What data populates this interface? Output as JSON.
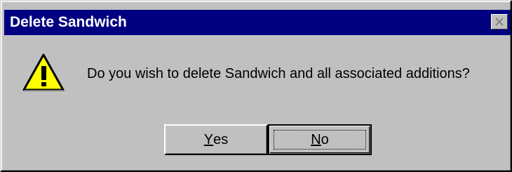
{
  "window": {
    "title": "Delete Sandwich",
    "close_icon": "close-icon"
  },
  "message": {
    "icon": "warning-icon",
    "text": "Do you wish to delete Sandwich and all associated additions?"
  },
  "buttons": {
    "yes": {
      "mnemonic": "Y",
      "rest": "es"
    },
    "no": {
      "mnemonic": "N",
      "rest": "o"
    }
  },
  "colors": {
    "titlebar": "#000080",
    "face": "#c0c0c0",
    "warning_fill": "#ffff00"
  }
}
